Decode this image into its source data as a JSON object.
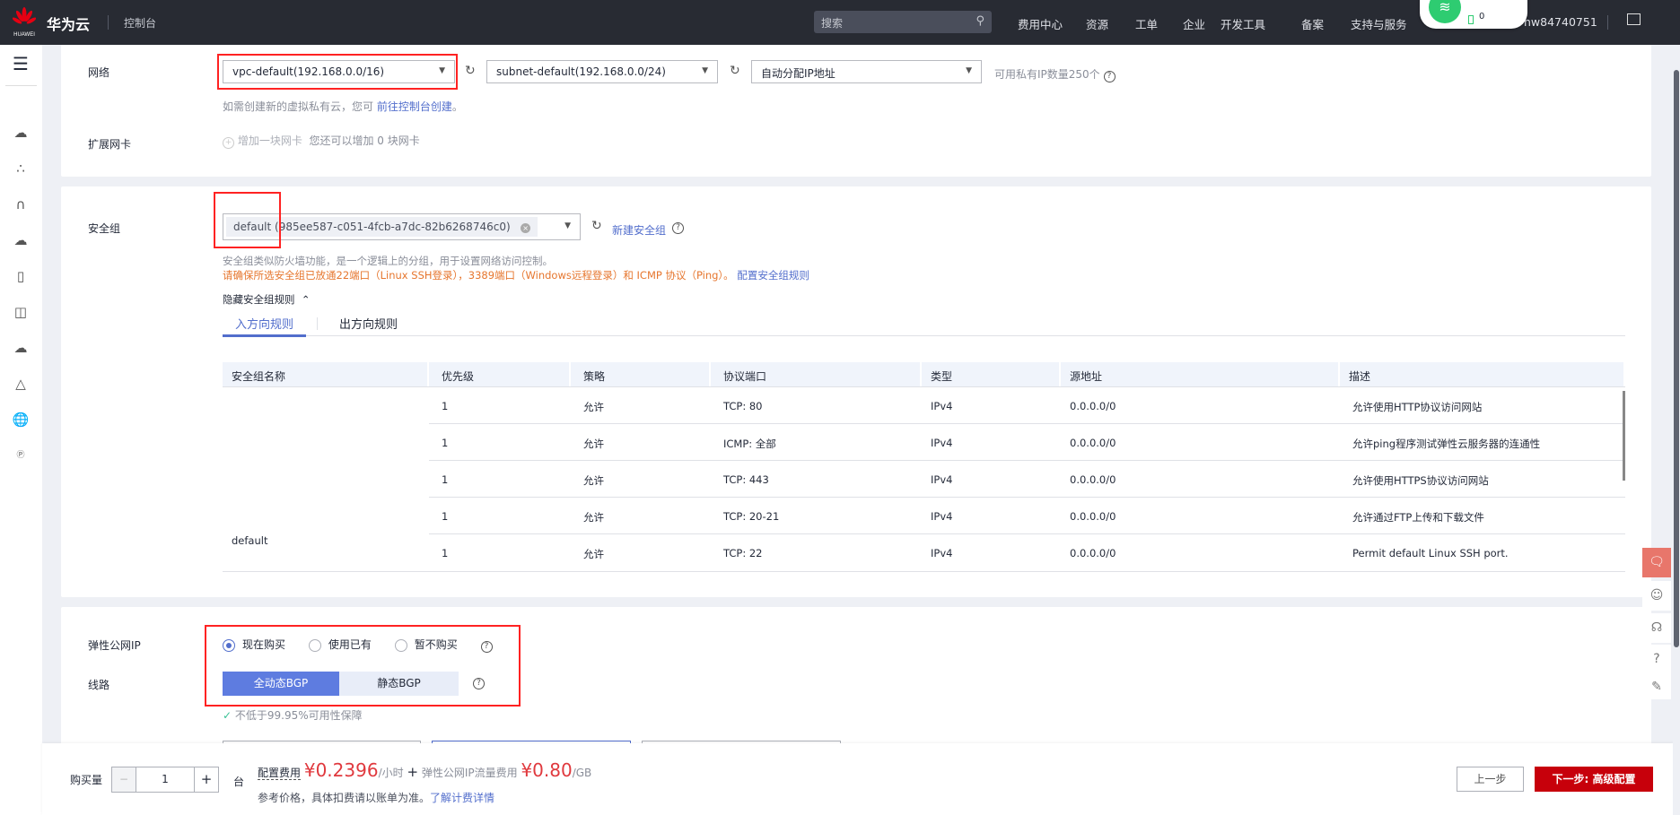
{
  "header": {
    "brand": "华为云",
    "logo_text": "HUAWEI",
    "console": "控制台",
    "search_placeholder": "搜索",
    "nav": [
      "费用中心",
      "资源",
      "工单",
      "企业",
      "开发工具",
      "备案",
      "支持与服务"
    ],
    "user": "hw84740751",
    "popup_count": "0"
  },
  "sidebar": {
    "icons": [
      "menu-icon",
      "cloud-server-icon",
      "cluster-icon",
      "bandwidth-icon",
      "cloud-storage-icon",
      "phone-icon",
      "tablet-icon",
      "cloud-edit-icon",
      "pyramid-icon",
      "globe-icon",
      "ip-icon"
    ]
  },
  "network": {
    "label": "网络",
    "vpc": "vpc-default(192.168.0.0/16)",
    "subnet": "subnet-default(192.168.0.0/24)",
    "ip_mode": "自动分配IP地址",
    "available": "可用私有IP数量250个",
    "hint": "如需创建新的虚拟私有云，您可",
    "hint_link": "前往控制台创建",
    "hint_end": "。",
    "ext_label": "扩展网卡",
    "add_nic": "增加一块网卡",
    "nic_remaining": "您还可以增加 0 块网卡"
  },
  "security": {
    "label": "安全组",
    "selected": "default (985ee587-c051-4fcb-a7dc-82b6268746c0)",
    "new_link": "新建安全组",
    "desc": "安全组类似防火墙功能，是一个逻辑上的分组，用于设置网络访问控制。",
    "warning": "请确保所选安全组已放通22端口（Linux SSH登录），3389端口（Windows远程登录）和 ICMP 协议（Ping）。",
    "config_link": "配置安全组规则",
    "toggle": "隐藏安全组规则",
    "tabs": [
      "入方向规则",
      "出方向规则"
    ],
    "columns": [
      "安全组名称",
      "优先级",
      "策略",
      "协议端口",
      "类型",
      "源地址",
      "描述"
    ],
    "group_name": "default",
    "rows": [
      {
        "priority": "1",
        "policy": "允许",
        "port": "TCP: 80",
        "type": "IPv4",
        "source": "0.0.0.0/0",
        "desc": "允许使用HTTP协议访问网站"
      },
      {
        "priority": "1",
        "policy": "允许",
        "port": "ICMP: 全部",
        "type": "IPv4",
        "source": "0.0.0.0/0",
        "desc": "允许ping程序测试弹性云服务器的连通性"
      },
      {
        "priority": "1",
        "policy": "允许",
        "port": "TCP: 443",
        "type": "IPv4",
        "source": "0.0.0.0/0",
        "desc": "允许使用HTTPS协议访问网站"
      },
      {
        "priority": "1",
        "policy": "允许",
        "port": "TCP: 20-21",
        "type": "IPv4",
        "source": "0.0.0.0/0",
        "desc": "允许通过FTP上传和下载文件"
      },
      {
        "priority": "1",
        "policy": "允许",
        "port": "TCP: 22",
        "type": "IPv4",
        "source": "0.0.0.0/0",
        "desc": "Permit default Linux SSH port."
      }
    ]
  },
  "eip": {
    "label": "弹性公网IP",
    "options": [
      "现在购买",
      "使用已有",
      "暂不购买"
    ],
    "selected": "现在购买",
    "line_label": "线路",
    "lines": [
      "全动态BGP",
      "静态BGP"
    ],
    "selected_line": "全动态BGP",
    "sla": "不低于99.95%可用性保障"
  },
  "footer": {
    "qty_label": "购买量",
    "qty": "1",
    "unit": "台",
    "config_fee_label": "配置费用",
    "config_fee": "¥0.2396",
    "config_fee_unit": "/小时",
    "plus": "+",
    "eip_fee_label": "弹性公网IP流量费用",
    "eip_fee": "¥0.80",
    "eip_fee_unit": "/GB",
    "note": "参考价格，具体扣费请以账单为准。",
    "note_link": "了解计费详情",
    "prev": "上一步",
    "next": "下一步: 高级配置"
  },
  "colors": {
    "header": "#282b33",
    "accent": "#526ecc",
    "primary_red": "#c7000b",
    "price": "#e0393e",
    "warning": "#e6762e"
  }
}
